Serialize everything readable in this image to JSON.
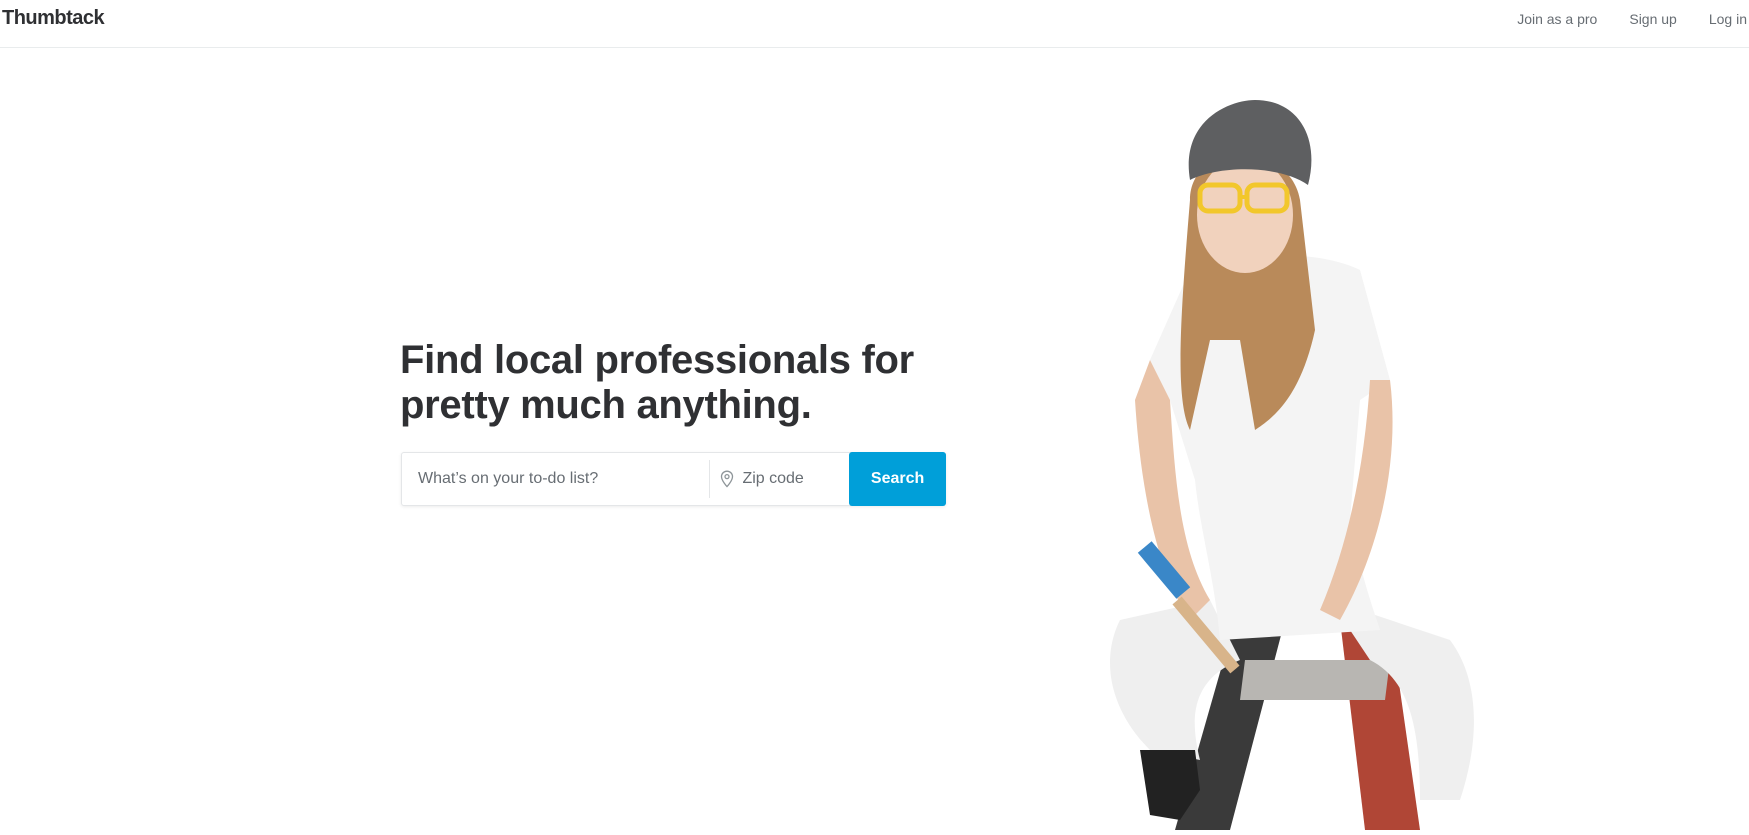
{
  "header": {
    "logo": "Thumbtack",
    "nav": {
      "join_as_pro": "Join as a pro",
      "sign_up": "Sign up",
      "log_in": "Log in"
    }
  },
  "hero": {
    "title_line1": "Find local professionals for",
    "title_line2": "pretty much anything.",
    "search": {
      "todo_placeholder": "What’s on your to-do list?",
      "todo_value": "",
      "zip_placeholder": "Zip code",
      "zip_value": "",
      "button_label": "Search",
      "location_icon": "location-pin-icon"
    },
    "image": {
      "subject": "painter-sitting-on-ladder-with-paintbrush"
    }
  },
  "colors": {
    "accent": "#009fd9",
    "text_primary": "#2f3033",
    "text_secondary": "#676d73",
    "border": "#e4e6e8"
  }
}
